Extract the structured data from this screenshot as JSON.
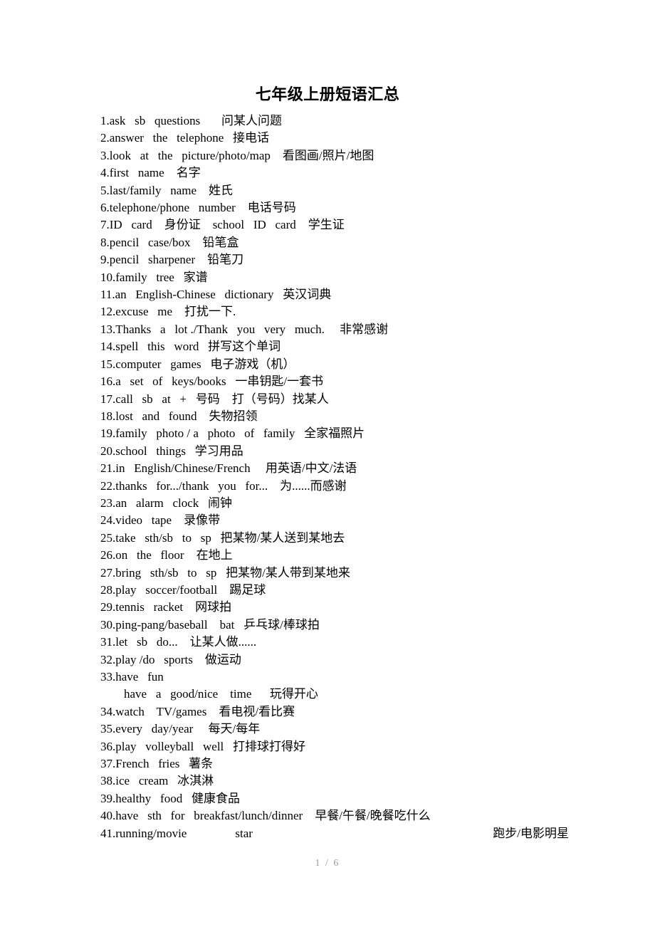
{
  "document": {
    "title": "七年级上册短语汇总",
    "page_background": "#ffffff",
    "text_color": "#000000",
    "footer": {
      "current_page": "1",
      "separator": "/",
      "total_pages": "6",
      "label": "1  /  6",
      "color": "#9b9b9b"
    }
  },
  "phrases": [
    {
      "n": "1",
      "text": "1.ask   sb   questions       问某人问题"
    },
    {
      "n": "2",
      "text": "2.answer   the   telephone   接电话"
    },
    {
      "n": "3",
      "text": "3.look   at   the   picture/photo/map    看图画/照片/地图"
    },
    {
      "n": "4",
      "text": "4.first   name    名字"
    },
    {
      "n": "5",
      "text": "5.last/family   name    姓氏"
    },
    {
      "n": "6",
      "text": "6.telephone/phone   number    电话号码"
    },
    {
      "n": "7",
      "text": "7.ID   card    身份证    school   ID   card    学生证"
    },
    {
      "n": "8",
      "text": "8.pencil   case/box    铅笔盒"
    },
    {
      "n": "9",
      "text": "9.pencil   sharpener    铅笔刀"
    },
    {
      "n": "10",
      "text": "10.family   tree   家谱"
    },
    {
      "n": "11",
      "text": "11.an   English-Chinese   dictionary   英汉词典"
    },
    {
      "n": "12",
      "text": "12.excuse   me    打扰一下."
    },
    {
      "n": "13",
      "text": "13.Thanks   a   lot ./Thank   you   very   much.     非常感谢"
    },
    {
      "n": "14",
      "text": "14.spell   this   word   拼写这个单词"
    },
    {
      "n": "15",
      "text": "15.computer   games   电子游戏（机）"
    },
    {
      "n": "16",
      "text": "16.a   set   of   keys/books   一串钥匙/一套书"
    },
    {
      "n": "17",
      "text": "17.call   sb   at   +   号码    打（号码）找某人"
    },
    {
      "n": "18",
      "text": "18.lost   and   found    失物招领"
    },
    {
      "n": "19",
      "text": "19.family   photo / a   photo   of   family   全家福照片"
    },
    {
      "n": "20",
      "text": "20.school   things   学习用品"
    },
    {
      "n": "21",
      "text": "21.in   English/Chinese/French     用英语/中文/法语"
    },
    {
      "n": "22",
      "text": "22.thanks   for.../thank   you   for...    为......而感谢"
    },
    {
      "n": "23",
      "text": "23.an   alarm   clock   闹钟"
    },
    {
      "n": "24",
      "text": "24.video   tape    录像带"
    },
    {
      "n": "25",
      "text": "25.take   sth/sb   to   sp   把某物/某人送到某地去"
    },
    {
      "n": "26",
      "text": "26.on   the   floor    在地上"
    },
    {
      "n": "27",
      "text": "27.bring   sth/sb   to   sp   把某物/某人带到某地来"
    },
    {
      "n": "28",
      "text": "28.play   soccer/football    踢足球"
    },
    {
      "n": "29",
      "text": "29.tennis   racket    网球拍"
    },
    {
      "n": "30",
      "text": "30.ping-pang/baseball    bat   乒乓球/棒球拍"
    },
    {
      "n": "31",
      "text": "31.let   sb   do...    让某人做......"
    },
    {
      "n": "32",
      "text": "32.play /do   sports    做运动"
    },
    {
      "n": "33",
      "text": "33.have   fun"
    },
    {
      "n": "33b",
      "text": "have   a   good/nice    time      玩得开心",
      "indent": true
    },
    {
      "n": "34",
      "text": "34.watch    TV/games    看电视/看比赛"
    },
    {
      "n": "35",
      "text": "35.every   day/year     每天/每年"
    },
    {
      "n": "36",
      "text": "36.play   volleyball   well   打排球打得好"
    },
    {
      "n": "37",
      "text": "37.French   fries   薯条"
    },
    {
      "n": "38",
      "text": "38.ice   cream   冰淇淋"
    },
    {
      "n": "39",
      "text": "39.healthy   food   健康食品"
    },
    {
      "n": "40",
      "text": "40.have   sth   for   breakfast/lunch/dinner    早餐/午餐/晚餐吃什么"
    }
  ],
  "last_line": {
    "left": "41.running/movie                star",
    "right": "跑步/电影明星"
  }
}
